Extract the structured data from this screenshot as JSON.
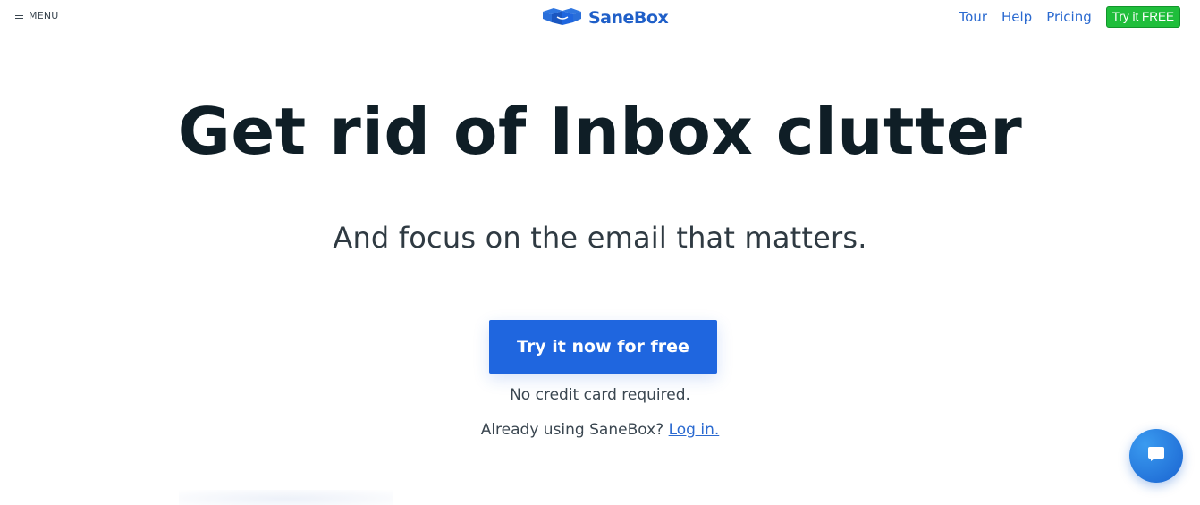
{
  "header": {
    "menu_label": "MENU",
    "logo_text": "SaneBox",
    "nav": {
      "tour": "Tour",
      "help": "Help",
      "pricing": "Pricing",
      "cta": "Try it FREE"
    }
  },
  "hero": {
    "headline": "Get rid of Inbox clutter",
    "subhead": "And focus on the email that matters.",
    "cta_label": "Try it now for free",
    "note": "No credit card required.",
    "login_prefix": "Already using SaneBox?",
    "login_link": "Log in."
  },
  "icons": {
    "menu": "hamburger-icon",
    "logo": "box-icon",
    "chat": "chat-bubble-icon"
  },
  "colors": {
    "brand_blue": "#1f66df",
    "link_blue": "#2b6ad0",
    "cta_green": "#1fbe3b",
    "headline": "#0f1e26"
  }
}
